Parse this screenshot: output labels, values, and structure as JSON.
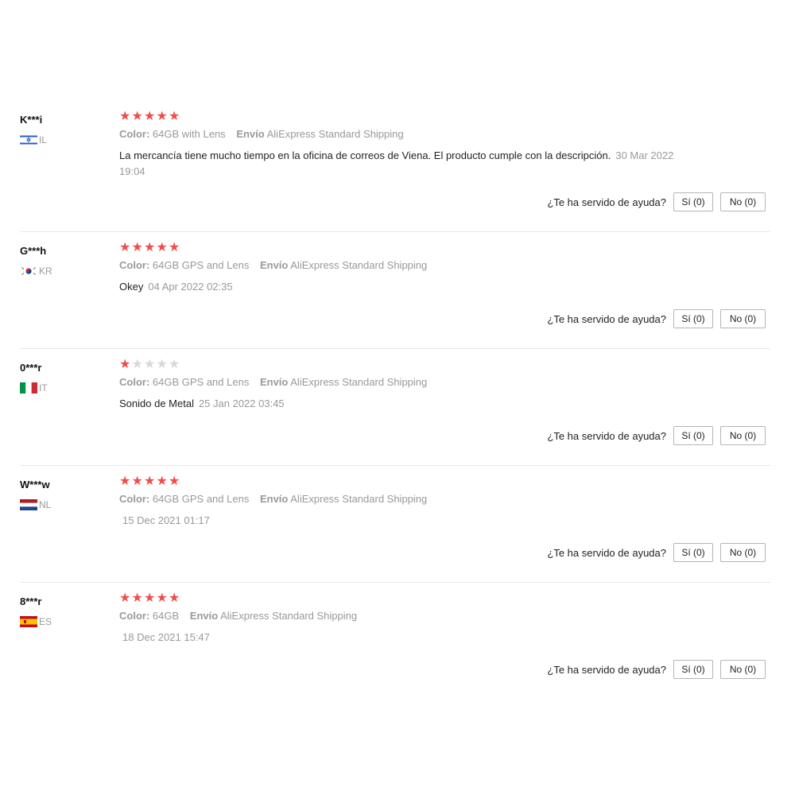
{
  "helpful_prompt": "¿Te ha servido de ayuda?",
  "color_label": "Color:",
  "shipping_label": "Envío",
  "accent_color": "#f24c4c",
  "reviews": [
    {
      "user": "K***i",
      "country": "IL",
      "flag_icon": "israel-flag-icon",
      "stars": 5,
      "color_value": "64GB with Lens",
      "shipping_value": "AliExpress Standard Shipping",
      "text": "La mercancía tiene mucho tiempo en la oficina de correos de Viena. El producto cumple con la descripción.",
      "date": "30 Mar 2022 19:04",
      "yes": "Sí (0)",
      "no": "No (0)"
    },
    {
      "user": "G***h",
      "country": "KR",
      "flag_icon": "south-korea-flag-icon",
      "stars": 5,
      "color_value": "64GB GPS and Lens",
      "shipping_value": "AliExpress Standard Shipping",
      "text": "Okey",
      "date": "04 Apr 2022 02:35",
      "yes": "Sí (0)",
      "no": "No (0)"
    },
    {
      "user": "0***r",
      "country": "IT",
      "flag_icon": "italy-flag-icon",
      "stars": 1,
      "color_value": "64GB GPS and Lens",
      "shipping_value": "AliExpress Standard Shipping",
      "text": "Sonido de Metal",
      "date": "25 Jan 2022 03:45",
      "yes": "Sí (0)",
      "no": "No (0)"
    },
    {
      "user": "W***w",
      "country": "NL",
      "flag_icon": "netherlands-flag-icon",
      "stars": 5,
      "color_value": "64GB GPS and Lens",
      "shipping_value": "AliExpress Standard Shipping",
      "text": "",
      "date": "15 Dec 2021 01:17",
      "yes": "Sí (0)",
      "no": "No (0)"
    },
    {
      "user": "8***r",
      "country": "ES",
      "flag_icon": "spain-flag-icon",
      "stars": 5,
      "color_value": "64GB",
      "shipping_value": "AliExpress Standard Shipping",
      "text": "",
      "date": "18 Dec 2021 15:47",
      "yes": "Sí (0)",
      "no": "No (0)"
    }
  ]
}
